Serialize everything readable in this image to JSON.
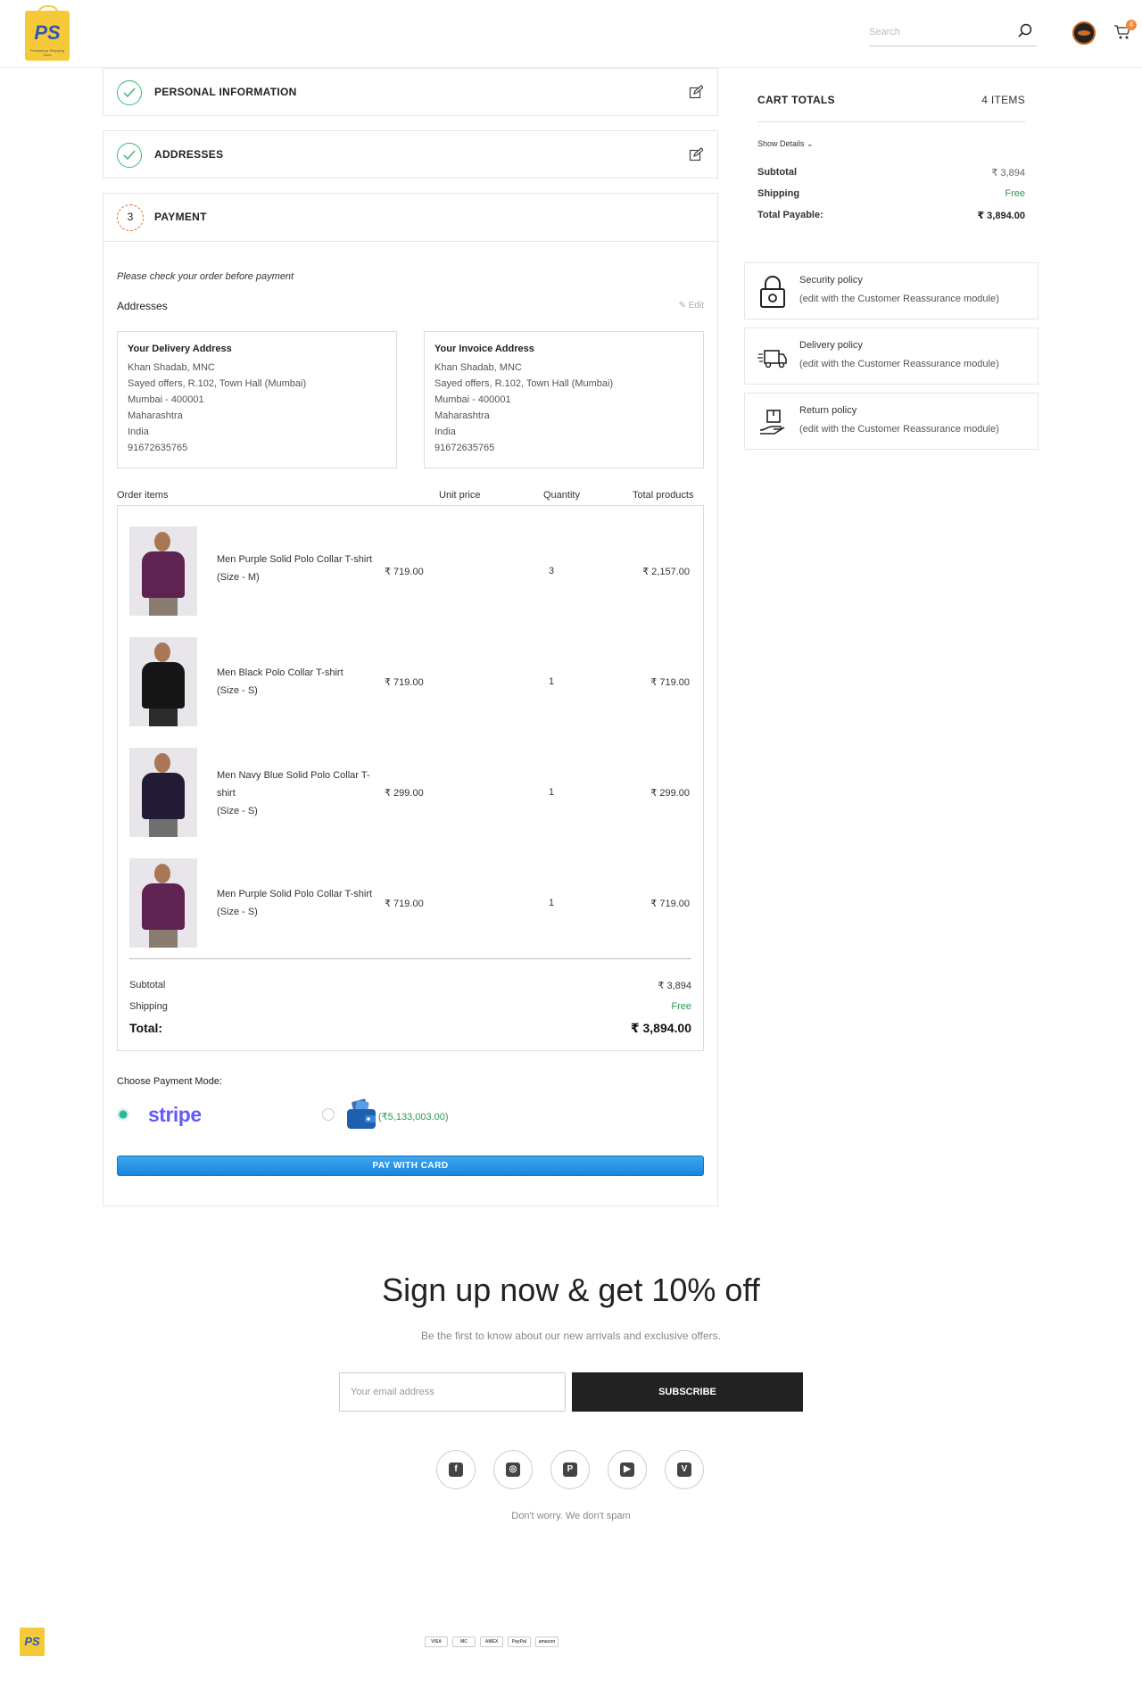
{
  "header": {
    "logo_text": "PS",
    "logo_subtext": "Prestashop Shopping Store",
    "search_placeholder": "Search",
    "cart_count": "4"
  },
  "steps": {
    "personal": "PERSONAL INFORMATION",
    "addresses": "ADDRESSES",
    "payment_number": "3",
    "payment": "PAYMENT"
  },
  "payment": {
    "note": "Please check your order before payment",
    "addresses_label": "Addresses",
    "edit_label": "Edit",
    "delivery": {
      "title": "Your Delivery Address",
      "lines": [
        "Khan Shadab, MNC",
        "Sayed offers, R.102, Town Hall (Mumbai)",
        "Mumbai - 400001",
        "Maharashtra",
        "India",
        "91672635765"
      ]
    },
    "invoice": {
      "title": "Your Invoice Address",
      "lines": [
        "Khan Shadab, MNC",
        "Sayed offers, R.102, Town Hall (Mumbai)",
        "Mumbai - 400001",
        "Maharashtra",
        "India",
        "91672635765"
      ]
    },
    "columns": {
      "items": "Order items",
      "unit_price": "Unit price",
      "quantity": "Quantity",
      "total": "Total products"
    },
    "items": [
      {
        "name": "Men Purple Solid Polo Collar T-shirt",
        "size": "(Size - M)",
        "price": "₹ 719.00",
        "qty": "3",
        "total": "₹ 2,157.00",
        "color": "#5e2350"
      },
      {
        "name": "Men Black Polo Collar T-shirt",
        "size": "(Size - S)",
        "price": "₹ 719.00",
        "qty": "1",
        "total": "₹ 719.00",
        "color": "#161616"
      },
      {
        "name": "Men Navy Blue Solid Polo Collar T-shirt",
        "size": "(Size - S)",
        "price": "₹ 299.00",
        "qty": "1",
        "total": "₹ 299.00",
        "color": "#231a33"
      },
      {
        "name": "Men Purple Solid Polo Collar T-shirt",
        "size": "(Size - S)",
        "price": "₹ 719.00",
        "qty": "1",
        "total": "₹ 719.00",
        "color": "#5e2350"
      }
    ],
    "summary": {
      "subtotal_label": "Subtotal",
      "subtotal": "₹ 3,894",
      "shipping_label": "Shipping",
      "shipping": "Free",
      "total_label": "Total:",
      "total": "₹ 3,894.00"
    },
    "mode_label": "Choose Payment Mode:",
    "stripe_label": "stripe",
    "wallet_amount": "(₹5,133,003.00)",
    "pay_button": "PAY WITH CARD"
  },
  "cart_totals": {
    "title": "CART TOTALS",
    "count": "4 ITEMS",
    "show_details": "Show Details",
    "subtotal_label": "Subtotal",
    "subtotal": "₹ 3,894",
    "shipping_label": "Shipping",
    "shipping": "Free",
    "total_label": "Total Payable:",
    "total": "₹ 3,894.00"
  },
  "policies": [
    {
      "title": "Security policy",
      "sub": "(edit with the Customer Reassurance module)",
      "icon": "lock-icon"
    },
    {
      "title": "Delivery policy",
      "sub": "(edit with the Customer Reassurance module)",
      "icon": "truck-icon"
    },
    {
      "title": "Return policy",
      "sub": "(edit with the Customer Reassurance module)",
      "icon": "return-box-icon"
    }
  ],
  "newsletter": {
    "title": "Sign up now & get 10% off",
    "subtitle": "Be the first to know about our new arrivals and exclusive offers.",
    "placeholder": "Your email address",
    "button": "SUBSCRIBE",
    "footnote": "Don't worry. We don't spam",
    "socials": [
      "facebook-icon",
      "instagram-icon",
      "pinterest-icon",
      "youtube-icon",
      "vimeo-icon"
    ]
  },
  "footer": {
    "logo_text": "PS",
    "payment_methods": [
      "VISA",
      "MC",
      "AMEX",
      "PayPal",
      "amazon"
    ]
  },
  "colors": {
    "accent_green": "#3cb878",
    "step_orange": "#ef6b3a",
    "stripe_purple": "#635bff",
    "pay_button_blue": "#1a86df"
  }
}
